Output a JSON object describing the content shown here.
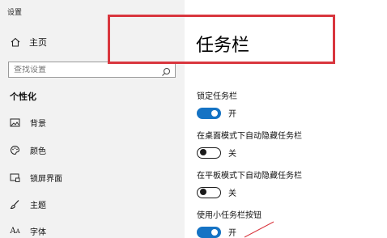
{
  "window": {
    "title": "设置"
  },
  "sidebar": {
    "home_label": "主页",
    "search": {
      "placeholder": "查找设置",
      "value": ""
    },
    "section_label": "个性化",
    "items": [
      {
        "label": "背景",
        "icon": "image-icon"
      },
      {
        "label": "颜色",
        "icon": "palette-icon"
      },
      {
        "label": "锁屏界面",
        "icon": "lock-screen-icon"
      },
      {
        "label": "主题",
        "icon": "brush-icon"
      },
      {
        "label": "字体",
        "icon": "font-icon"
      }
    ]
  },
  "main": {
    "title": "任务栏",
    "settings": [
      {
        "label": "锁定任务栏",
        "state": "开",
        "on": true
      },
      {
        "label": "在桌面模式下自动隐藏任务栏",
        "state": "关",
        "on": false
      },
      {
        "label": "在平板模式下自动隐藏任务栏",
        "state": "关",
        "on": false
      },
      {
        "label": "使用小任务栏按钮",
        "state": "开",
        "on": true
      }
    ]
  },
  "colors": {
    "accent": "#1573c4",
    "highlight": "#d9363e",
    "sidebar_bg": "#f2f2f2"
  }
}
